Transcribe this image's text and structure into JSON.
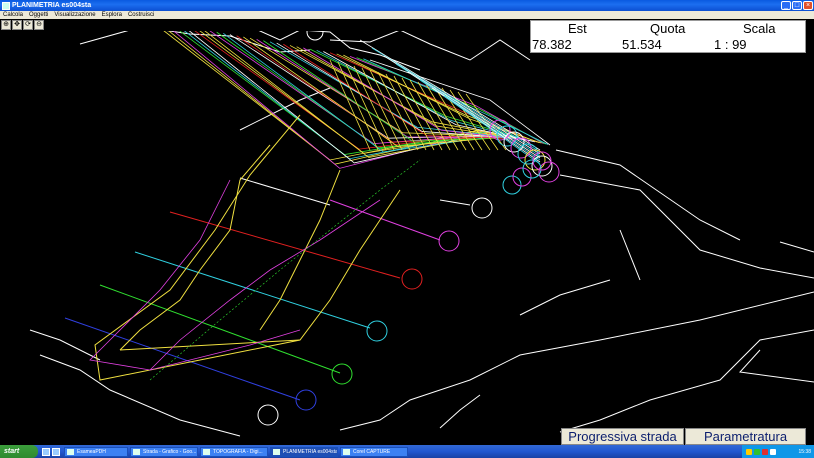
{
  "window": {
    "title": "PLANIMETRIA es004sta",
    "controls": [
      "minimize-icon",
      "maximize-icon",
      "close-icon"
    ]
  },
  "menu": {
    "items": [
      "Calcola",
      "Oggetti",
      "Visualizzazione",
      "Esplora",
      "Costruisci"
    ]
  },
  "toolbar": {
    "tools": [
      "zoom-icon",
      "pan-icon",
      "refresh-icon",
      "zoom-out-icon"
    ]
  },
  "info": {
    "headers": {
      "est": "Est",
      "quota": "Quota",
      "scala": "Scala"
    },
    "values": {
      "est": "78.382",
      "quota": "51.534",
      "scala": "1 : 99"
    }
  },
  "buttons": {
    "progressiva": "Progressiva strada",
    "parametratura": "Parametratura"
  },
  "taskbar": {
    "start": "start",
    "tasks": [
      {
        "label": "EsameaPDH",
        "active": false
      },
      {
        "label": "Strada - Grafico - Goo...",
        "active": false
      },
      {
        "label": "TOPOGRAFIA - Digi...",
        "active": false
      },
      {
        "label": "PLANIMETRIA es004sta",
        "active": true
      },
      {
        "label": "Corel CAPTURE",
        "active": false
      }
    ],
    "clock": "15:38"
  },
  "colors": {
    "background": "#000000",
    "lines_white": "#ffffff",
    "lines_yellow": "#f0e040",
    "lines_magenta": "#e040e0",
    "lines_red": "#e02020",
    "lines_cyan": "#30d0e0",
    "lines_green": "#30e030",
    "lines_blue": "#3040e0",
    "button_text": "#0b1e6e"
  }
}
